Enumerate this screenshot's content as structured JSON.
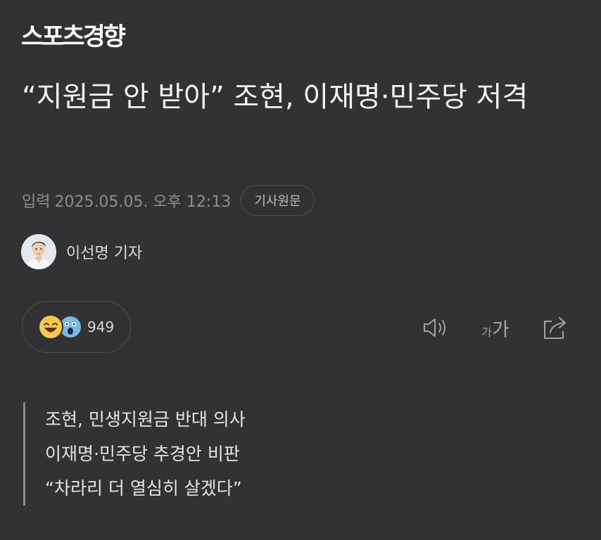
{
  "brand": {
    "logo_text": "스포츠경향"
  },
  "article": {
    "headline": "“지원금 안 받아” 조현, 이재명·민주당 저격",
    "published_label": "입력",
    "published_datetime": "2025.05.05. 오후 12:13",
    "source_button_label": "기사원문"
  },
  "reporter": {
    "name": "이선명 기자"
  },
  "reactions": {
    "count": "949",
    "emojis": [
      "laughing-face",
      "shocked-face"
    ]
  },
  "toolbar": {
    "sound_icon": "speaker-icon",
    "font_small": "가",
    "font_large": "가",
    "share_icon": "share-icon"
  },
  "summary": {
    "lines": [
      "조현, 민생지원금 반대 의사",
      "이재명·민주당 추경안 비판",
      "“차라리 더 열심히 살겠다”"
    ]
  },
  "colors": {
    "background": "#323234",
    "text_primary": "#f2f2f2",
    "text_muted": "#8e8e90",
    "border": "#4e4e51",
    "emoji_yellow": "#f7c94b",
    "emoji_blue": "#7ab8e8"
  }
}
